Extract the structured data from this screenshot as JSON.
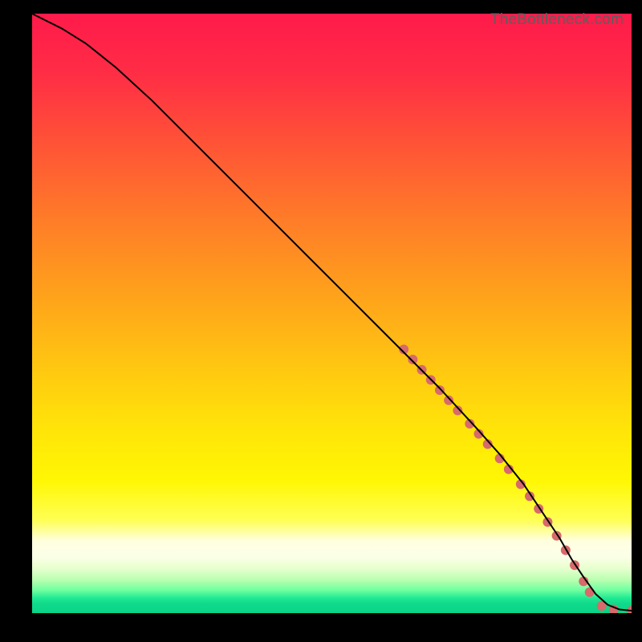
{
  "watermark": "TheBottleneck.com",
  "gradient": {
    "stops": [
      {
        "offset": 0.0,
        "color": "#ff1a4b"
      },
      {
        "offset": 0.1,
        "color": "#ff2d45"
      },
      {
        "offset": 0.22,
        "color": "#ff5436"
      },
      {
        "offset": 0.35,
        "color": "#ff7e27"
      },
      {
        "offset": 0.48,
        "color": "#ffa51a"
      },
      {
        "offset": 0.6,
        "color": "#ffca10"
      },
      {
        "offset": 0.7,
        "color": "#ffe608"
      },
      {
        "offset": 0.78,
        "color": "#fff704"
      },
      {
        "offset": 0.845,
        "color": "#ffff55"
      },
      {
        "offset": 0.88,
        "color": "#ffffe0"
      },
      {
        "offset": 0.905,
        "color": "#fcffe8"
      },
      {
        "offset": 0.925,
        "color": "#e8ffcf"
      },
      {
        "offset": 0.945,
        "color": "#b7ffb0"
      },
      {
        "offset": 0.962,
        "color": "#6dffa0"
      },
      {
        "offset": 0.975,
        "color": "#20e993"
      },
      {
        "offset": 0.985,
        "color": "#0fd98a"
      },
      {
        "offset": 1.0,
        "color": "#0ad488"
      }
    ]
  },
  "chart_data": {
    "type": "line",
    "title": "",
    "xlabel": "",
    "ylabel": "",
    "xlim": [
      0,
      100
    ],
    "ylim": [
      0,
      100
    ],
    "series": [
      {
        "name": "curve",
        "x": [
          0,
          2,
          5,
          9,
          14,
          20,
          28,
          36,
          44,
          52,
          60,
          68,
          74,
          78,
          82,
          85,
          88,
          90,
          92,
          94,
          96,
          98,
          100
        ],
        "y": [
          100,
          99,
          97.5,
          95,
          91,
          85.5,
          77.5,
          69.5,
          61.5,
          53.5,
          45.5,
          37.5,
          31,
          26.5,
          21.5,
          17,
          12.5,
          9,
          6,
          3.2,
          1.4,
          0.6,
          0.4
        ]
      }
    ],
    "markers": {
      "name": "highlight-dots",
      "color": "#d76a6a",
      "radius": 6,
      "points": [
        {
          "x": 62,
          "y": 44
        },
        {
          "x": 63.5,
          "y": 42.3
        },
        {
          "x": 65,
          "y": 40.6
        },
        {
          "x": 66.5,
          "y": 38.9
        },
        {
          "x": 68,
          "y": 37.2
        },
        {
          "x": 69.5,
          "y": 35.5
        },
        {
          "x": 71,
          "y": 33.8
        },
        {
          "x": 73,
          "y": 31.6
        },
        {
          "x": 74.5,
          "y": 29.9
        },
        {
          "x": 76,
          "y": 28.2
        },
        {
          "x": 78,
          "y": 25.8
        },
        {
          "x": 79.5,
          "y": 24
        },
        {
          "x": 81.5,
          "y": 21.5
        },
        {
          "x": 83,
          "y": 19.5
        },
        {
          "x": 84.5,
          "y": 17.4
        },
        {
          "x": 86,
          "y": 15.2
        },
        {
          "x": 87.5,
          "y": 12.9
        },
        {
          "x": 89,
          "y": 10.5
        },
        {
          "x": 90.5,
          "y": 8
        },
        {
          "x": 92,
          "y": 5.3
        },
        {
          "x": 93,
          "y": 3.5
        },
        {
          "x": 95,
          "y": 1.2
        },
        {
          "x": 97,
          "y": 0.6
        },
        {
          "x": 100,
          "y": 0.4
        }
      ]
    }
  }
}
